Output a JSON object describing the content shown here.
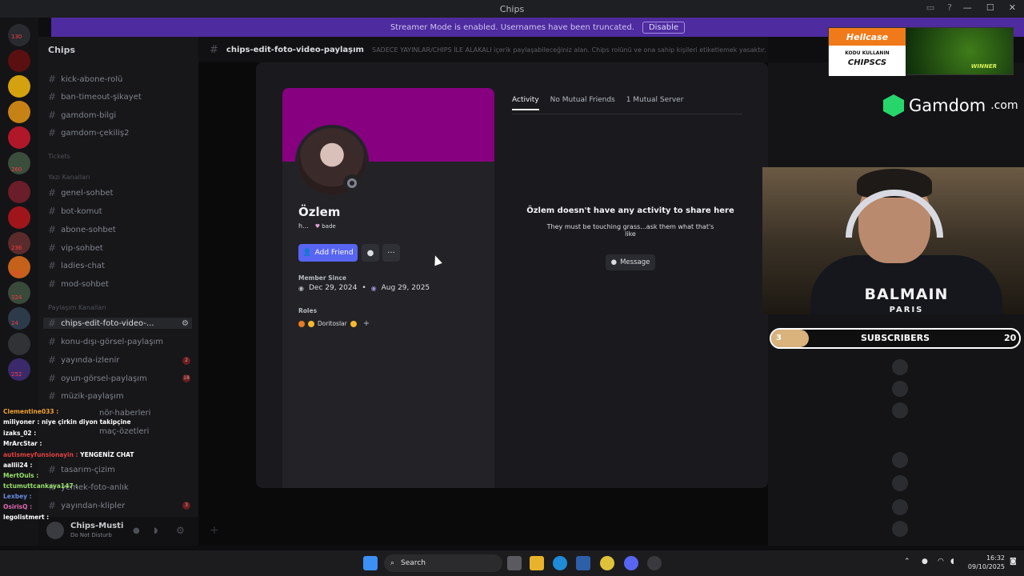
{
  "window": {
    "title": "Chips"
  },
  "streamer_banner": {
    "text": "Streamer Mode is enabled. Usernames have been truncated.",
    "disable_label": "Disable"
  },
  "server": {
    "name": "Chips"
  },
  "rail_counts": [
    "130",
    "260",
    "236",
    "384",
    "324",
    "24",
    "252"
  ],
  "channels": [
    {
      "label": "kick-abone-rolü"
    },
    {
      "label": "ban-timeout-şikayet"
    },
    {
      "label": "gamdom-bilgi"
    },
    {
      "label": "gamdom-çekiliş2"
    },
    {
      "label": "genel-sohbet"
    },
    {
      "label": "bot-komut"
    },
    {
      "label": "abone-sohbet"
    },
    {
      "label": "vip-sohbet"
    },
    {
      "label": "ladies-chat"
    },
    {
      "label": "mod-sohbet"
    },
    {
      "label": "chips-edit-foto-video-..."
    },
    {
      "label": "konu-dışı-görsel-paylaşım"
    },
    {
      "label": "yayında-izlenir"
    },
    {
      "label": "oyun-görsel-paylaşım"
    },
    {
      "label": "müzik-paylaşım"
    },
    {
      "label": "nör-haberleri"
    },
    {
      "label": "maç-özetleri"
    },
    {
      "label": "tasarım-çizim"
    },
    {
      "label": "yemek-foto-anlık"
    },
    {
      "label": "yayından-klipler"
    }
  ],
  "categories": [
    "Tickets",
    "Yazı Kanalları",
    "Paylaşım Kanalları"
  ],
  "channel_badges": [
    "2",
    "18",
    "3"
  ],
  "current_user": {
    "name": "Chips-Musti",
    "status": "Do Not Disturb"
  },
  "channel_header": {
    "name": "chips-edit-foto-video-paylaşım",
    "topic": "SADECE YAYINLAR/CHIPS İLE ALAKALI içerik paylaşabileceğiniz alan. Chips rolünü ve ona sahip kişileri etiketlemek yasaktır."
  },
  "stream_chat": [
    {
      "user": "Clementine033",
      "msg": "",
      "color": "#f0a030"
    },
    {
      "user": "miliyoner",
      "msg": "niye çirkin diyon takipçine",
      "color": "#ffffff"
    },
    {
      "user": "izaks_02",
      "msg": "",
      "color": "#ffffff"
    },
    {
      "user": "MrArcStar",
      "msg": "",
      "color": "#ffffff"
    },
    {
      "user": "autismeyfunsionayin",
      "msg": "YENGENİZ CHAT",
      "color": "#e04040"
    },
    {
      "user": "aallii24",
      "msg": "",
      "color": "#ffffff"
    },
    {
      "user": "MertOuls",
      "msg": "",
      "color": "#9ae06a"
    },
    {
      "user": "tctumuttcankaya147",
      "msg": "",
      "color": "#9ae06a"
    },
    {
      "user": "Lexbey",
      "msg": "",
      "color": "#6a8ae0"
    },
    {
      "user": "OsirisQ",
      "msg": "",
      "color": "#e06ab0"
    },
    {
      "user": "legolistmert",
      "msg": "",
      "color": "#ffffff"
    }
  ],
  "profile": {
    "display_name": "Özlem",
    "username": "h...",
    "tag": "bade",
    "add_friend_label": "Add Friend",
    "member_since_label": "Member Since",
    "discord_since": "Dec 29, 2024",
    "server_since": "Aug 29, 2025",
    "roles_label": "Roles",
    "role_name": "Doritoslar",
    "banner_color": "#86007f"
  },
  "tabs": [
    {
      "label": "Activity",
      "active": true
    },
    {
      "label": "No Mutual Friends",
      "active": false
    },
    {
      "label": "1 Mutual Server",
      "active": false
    }
  ],
  "activity": {
    "title": "Özlem doesn't have any activity to share here",
    "subtitle": "They must be touching grass...ask them what that's like",
    "message_label": "Message"
  },
  "sponsor": {
    "hellcase": "Hellcase",
    "kodu": "KODU KULLANIN",
    "code": "CHIPSCS",
    "winner": "WINNER",
    "gamdom": "Gamdom",
    "gamdom_suffix": ".com"
  },
  "webcam": {
    "shirt_brand": "BALMAIN",
    "shirt_city": "PARIS"
  },
  "subscriber_goal": {
    "current": "3",
    "label": "SUBSCRIBERS",
    "goal": "20",
    "progress": 0.15
  },
  "taskbar": {
    "search_label": "Search",
    "time": "16:32",
    "date": "09/10/2025"
  }
}
